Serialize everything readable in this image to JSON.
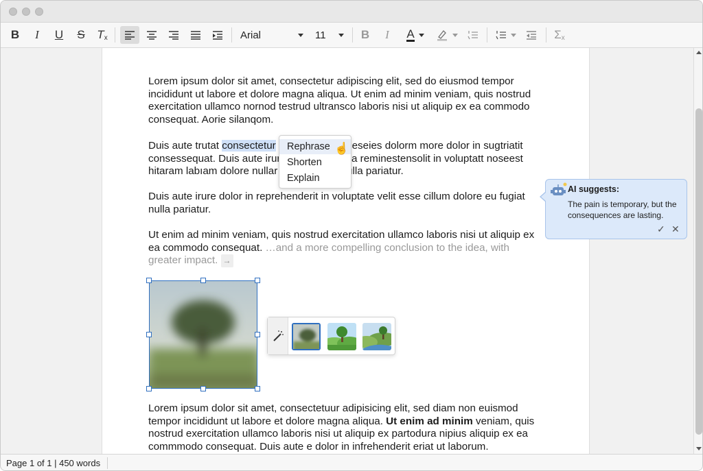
{
  "toolbar": {
    "font_family": "Arial",
    "font_size": "11",
    "bold": "B",
    "italic": "I",
    "underline": "U",
    "strike": "S",
    "clear_format": "T",
    "bold2": "B",
    "italic2": "I",
    "font_color": "A",
    "sum": "Σ"
  },
  "document": {
    "para1": "Lorem ipsum dolor sit amet, consectetur adipiscing elit, sed do eiusmod tempor incididunt ut labore et dolore magna aliqua. Ut enim ad minim veniam, quis nostrud exercitation ullamco nornod testrud ultransco laboris nisi ut aliquip ex ea commodo consequat. Aorie silanqom.",
    "para2_before": "Duis aute trutat ",
    "para2_selected": "consectetur",
    "para2_line1_tail": "seseies dolorm more dolor in sugtriatit",
    "para2_line2_head": "consessequat. Duis aute irur",
    "para2_line2_tail": "a reminestensolit in voluptatt noseest",
    "para2_line3_head": "hitaram labıam dolore nullar",
    "para2_line3_tail": "ulla pariatur.",
    "para3": "Duis aute irure dolor in reprehenderit in voluptate velit esse cillum dolore eu fugiat nulla pariatur.",
    "para4": "Ut enim ad minim veniam, quis nostrud exercitation ullamco laboris nisi ut aliquip ex ea commodo consequat.",
    "para4_suggestion": " …and a more compelling conclusion to the idea, with greater impact.",
    "para4_accept": "→",
    "para5_a": "Lorem ipsum dolor sit amet, consectetuur adipisicing elit, sed diam non euismod tempor incididunt ut labore et dolore magna aliqua. ",
    "para5_bold": "Ut enim ad minim",
    "para5_b": " veniam, quis nostrud exercitation ullamco laboris nisi ut aliquip ex partodura nipius aliquip ex ea commmodo consequat. Duis aute e dolor in infrehenderit eriat ut laborum."
  },
  "context_menu": {
    "items": [
      "Rephrase",
      "Shorten",
      "Explain"
    ]
  },
  "ai_panel": {
    "title": "AI suggests:",
    "text": "The pain is temporary, but the consequences are lasting.",
    "accept": "✓",
    "reject": "✕"
  },
  "status": {
    "text": "Page 1 of 1 | 450 words"
  }
}
